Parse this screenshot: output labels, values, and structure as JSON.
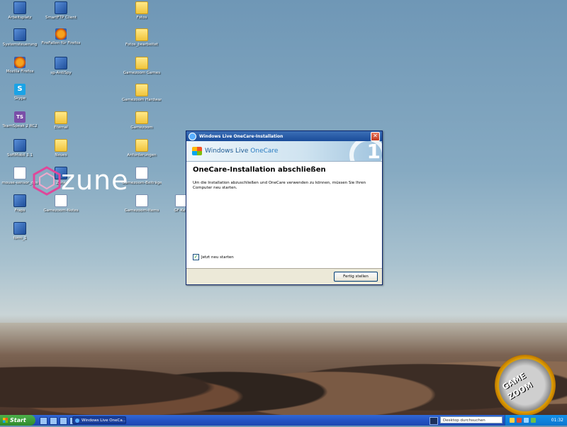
{
  "desktop": {
    "icons": [
      {
        "label": "Arbeitsplatz",
        "glyph": "app",
        "icon": "computer-icon"
      },
      {
        "label": "Systemsteuerung",
        "glyph": "app",
        "icon": "control-panel-icon"
      },
      {
        "label": "Mozilla Firefox",
        "glyph": "fox",
        "icon": "firefox-icon"
      },
      {
        "label": "Skype",
        "glyph": "skype",
        "icon": "skype-icon"
      },
      {
        "label": "TeamSpeak 2 RC2",
        "glyph": "ts",
        "icon": "teamspeak-icon"
      },
      {
        "label": "SoftMobil 3.1",
        "glyph": "app",
        "icon": "app-icon"
      },
      {
        "label": "mouse-sensor_dps",
        "glyph": "doc",
        "icon": "mouse-icon"
      },
      {
        "label": "Fraps",
        "glyph": "app",
        "icon": "fraps-icon"
      },
      {
        "label": "form_1",
        "glyph": "app",
        "icon": "paint-icon"
      },
      {
        "label": "SmartFTP Client",
        "glyph": "app",
        "icon": "smartftp-icon"
      },
      {
        "label": "FireFallen für Firefox",
        "glyph": "fox",
        "icon": "firefox-icon"
      },
      {
        "label": "sp-AntiSpy",
        "glyph": "app",
        "icon": "antispy-icon"
      },
      {
        "label": "Eternal",
        "glyph": "folder",
        "icon": "folder-icon"
      },
      {
        "label": "Neues",
        "glyph": "folder",
        "icon": "folder-icon"
      },
      {
        "label": "Zune",
        "glyph": "app",
        "icon": "zune-icon"
      },
      {
        "label": "Gamezoom-Notes",
        "glyph": "doc",
        "icon": "document-icon"
      },
      {
        "label": "Fotos",
        "glyph": "folder",
        "icon": "folder-icon"
      },
      {
        "label": "Fotos_bearbeitet",
        "glyph": "folder",
        "icon": "folder-icon"
      },
      {
        "label": "Gamezoom Games",
        "glyph": "folder",
        "icon": "folder-icon"
      },
      {
        "label": "Gamezoom Hardware",
        "glyph": "folder",
        "icon": "folder-icon"
      },
      {
        "label": "Gamezoom",
        "glyph": "folder",
        "icon": "folder-icon"
      },
      {
        "label": "Anforderungen",
        "glyph": "folder",
        "icon": "folder-icon"
      },
      {
        "label": "Gamezoom-Beiträge",
        "glyph": "doc",
        "icon": "word-document-icon"
      },
      {
        "label": "Gamezoom-Items",
        "glyph": "doc",
        "icon": "word-document-icon"
      },
      {
        "label": "GF-Ke...",
        "glyph": "doc",
        "icon": "word-document-icon"
      }
    ],
    "wallpaper_logo": "zune",
    "watermark": {
      "line1": "GAME",
      "line2": "ZOOM"
    }
  },
  "dialog": {
    "title": "Windows Live OneCare-Installation",
    "banner_brand": "Windows Live",
    "banner_product": "OneCare",
    "banner_badge": "1",
    "heading": "OneCare-Installation abschließen",
    "message": "Um die Installation abzuschließen und OneCare verwenden zu können, müssen Sie Ihren Computer neu starten.",
    "restart_label": "Jetzt neu starten",
    "restart_checked": true,
    "finish_label": "Fertig stellen",
    "close_glyph": "✕"
  },
  "taskbar": {
    "start_label": "Start",
    "task_label": "Windows Live OneCa...",
    "search_placeholder": "Desktop durchsuchen",
    "clock": "01:32"
  }
}
